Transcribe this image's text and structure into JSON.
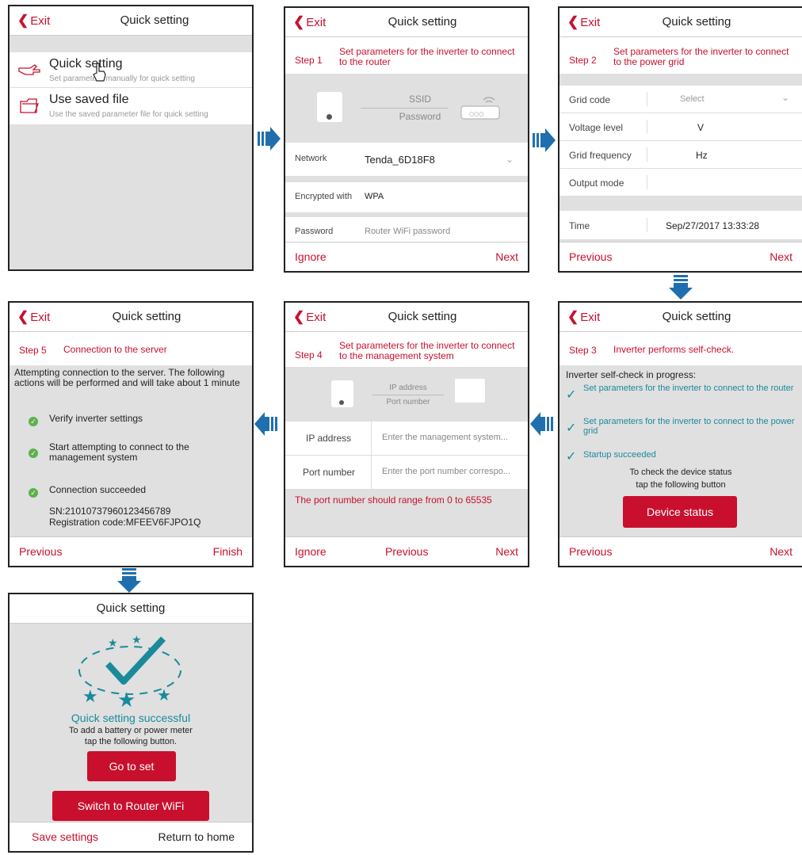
{
  "colors": {
    "accent": "#c8102e",
    "teal": "#1a8a9a",
    "arrow": "#1f6fae"
  },
  "common": {
    "exit": "Exit",
    "title": "Quick setting",
    "ignore": "Ignore",
    "next": "Next",
    "previous": "Previous",
    "finish": "Finish"
  },
  "p1": {
    "items": [
      {
        "label": "Quick setting",
        "sub": "Set parameters manually for quick setting"
      },
      {
        "label": "Use saved file",
        "sub": "Use the saved parameter file for quick setting"
      }
    ]
  },
  "p2": {
    "step": "Step 1",
    "desc": "Set parameters for the inverter to connect to the router",
    "diagram": {
      "ssid": "SSID",
      "password": "Password"
    },
    "network_label": "Network",
    "network_value": "Tenda_6D18F8",
    "enc_label": "Encrypted with",
    "enc_value": "WPA",
    "pwd_label": "Password",
    "pwd_placeholder": "Router WiFi password"
  },
  "p3": {
    "step": "Step 2",
    "desc": "Set parameters for the inverter to connect to the power grid",
    "grid_code": "Grid code",
    "grid_code_value": "Select",
    "voltage": "Voltage level",
    "voltage_unit": "V",
    "freq": "Grid frequency",
    "freq_unit": "Hz",
    "output": "Output mode",
    "time_label": "Time",
    "time_value": "Sep/27/2017 13:33:28"
  },
  "p4": {
    "step": "Step 3",
    "desc": "Inverter performs self-check.",
    "progress": "Inverter self-check in progress:",
    "checks": [
      "Set parameters for the inverter to connect to the router",
      "Set parameters for the inverter to connect to the power grid",
      "Startup succeeded"
    ],
    "hint1": "To check the device status",
    "hint2": "tap the following button",
    "button": "Device status"
  },
  "p5": {
    "step": "Step 4",
    "desc": "Set parameters for the inverter to connect to the management system",
    "diagram": {
      "ip": "IP address",
      "port": "Port number"
    },
    "ip_label": "IP address",
    "ip_placeholder": "Enter the management system...",
    "port_label": "Port number",
    "port_placeholder": "Enter the port number correspo...",
    "warning": "The port number should range from 0 to 65535"
  },
  "p6": {
    "step": "Step 5",
    "desc": "Connection to the server",
    "intro": "Attempting connection to the server. The following actions will be performed and will take about 1 minute",
    "items": [
      "Verify inverter settings",
      "Start attempting to connect to the management system",
      "Connection succeeded"
    ],
    "sn": "SN:21010737960123456789",
    "reg": "Registration code:MFEEV6FJPO1Q"
  },
  "p7": {
    "success": "Quick setting successful",
    "hint1": "To add a battery or power meter",
    "hint2": "tap the following button.",
    "goto": "Go to set",
    "switch": "Switch to Router WiFi",
    "save": "Save settings",
    "home": "Return to home"
  }
}
